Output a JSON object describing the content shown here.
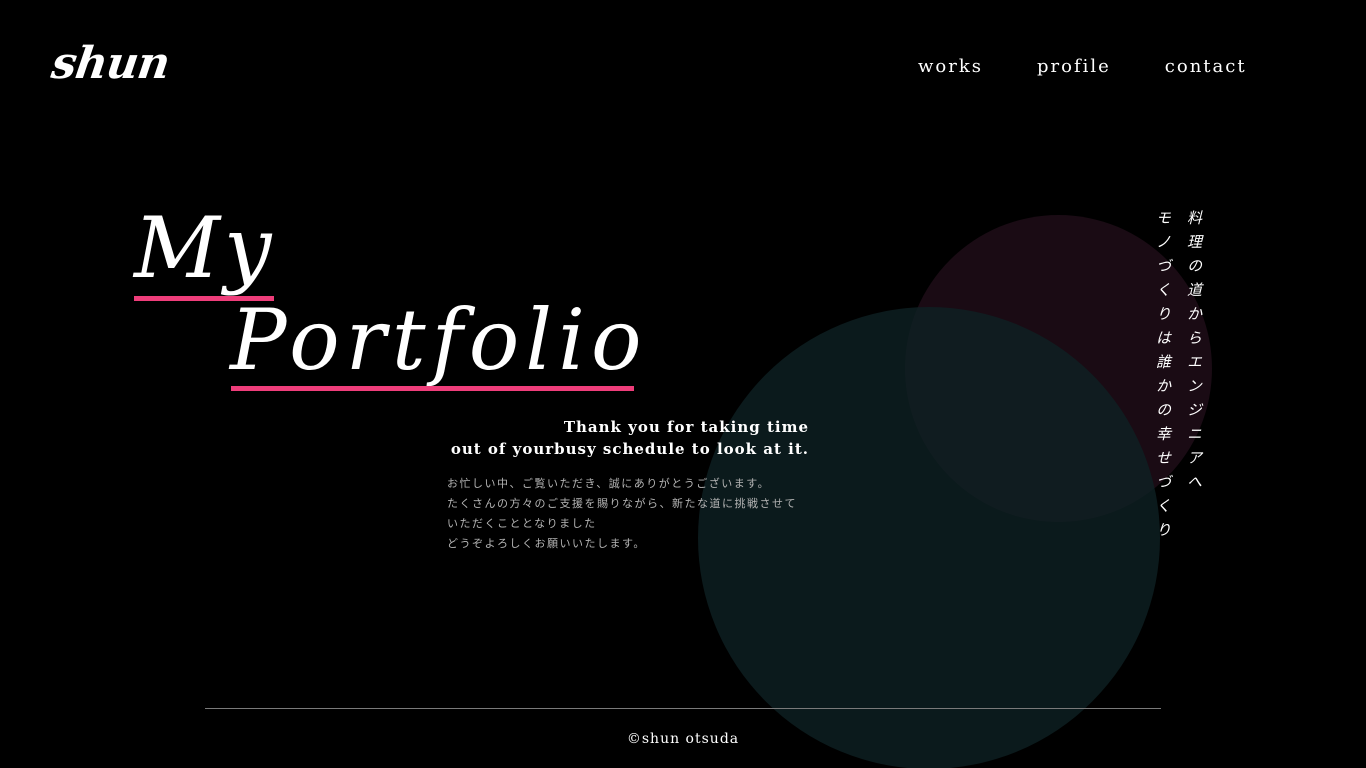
{
  "header": {
    "logo": "shun",
    "nav": [
      {
        "label": "works"
      },
      {
        "label": "profile"
      },
      {
        "label": "contact"
      }
    ]
  },
  "hero": {
    "title_line1": "My",
    "title_line2": "Portfolio",
    "thanks_line1": "Thank you for taking time",
    "thanks_line2": "out of yourbusy schedule to look at it.",
    "message_lines": [
      "お忙しい中、ご覧いただき、誠にありがとうございます。",
      "たくさんの方々のご支援を賜りながら、新たな道に挑戦させて",
      "いただくこととなりました",
      "どうぞよろしくお願いいたします。"
    ]
  },
  "vertical_text": {
    "line1": "料理の道からエンジニアへ",
    "line2": "モノづくりは誰かの幸せづくり"
  },
  "footer": {
    "copyright": "©shun otsuda"
  },
  "colors": {
    "background": "#000000",
    "accent": "#ee3d7a",
    "circle_pink": "#1a0b14",
    "circle_teal": "#0e2124"
  }
}
